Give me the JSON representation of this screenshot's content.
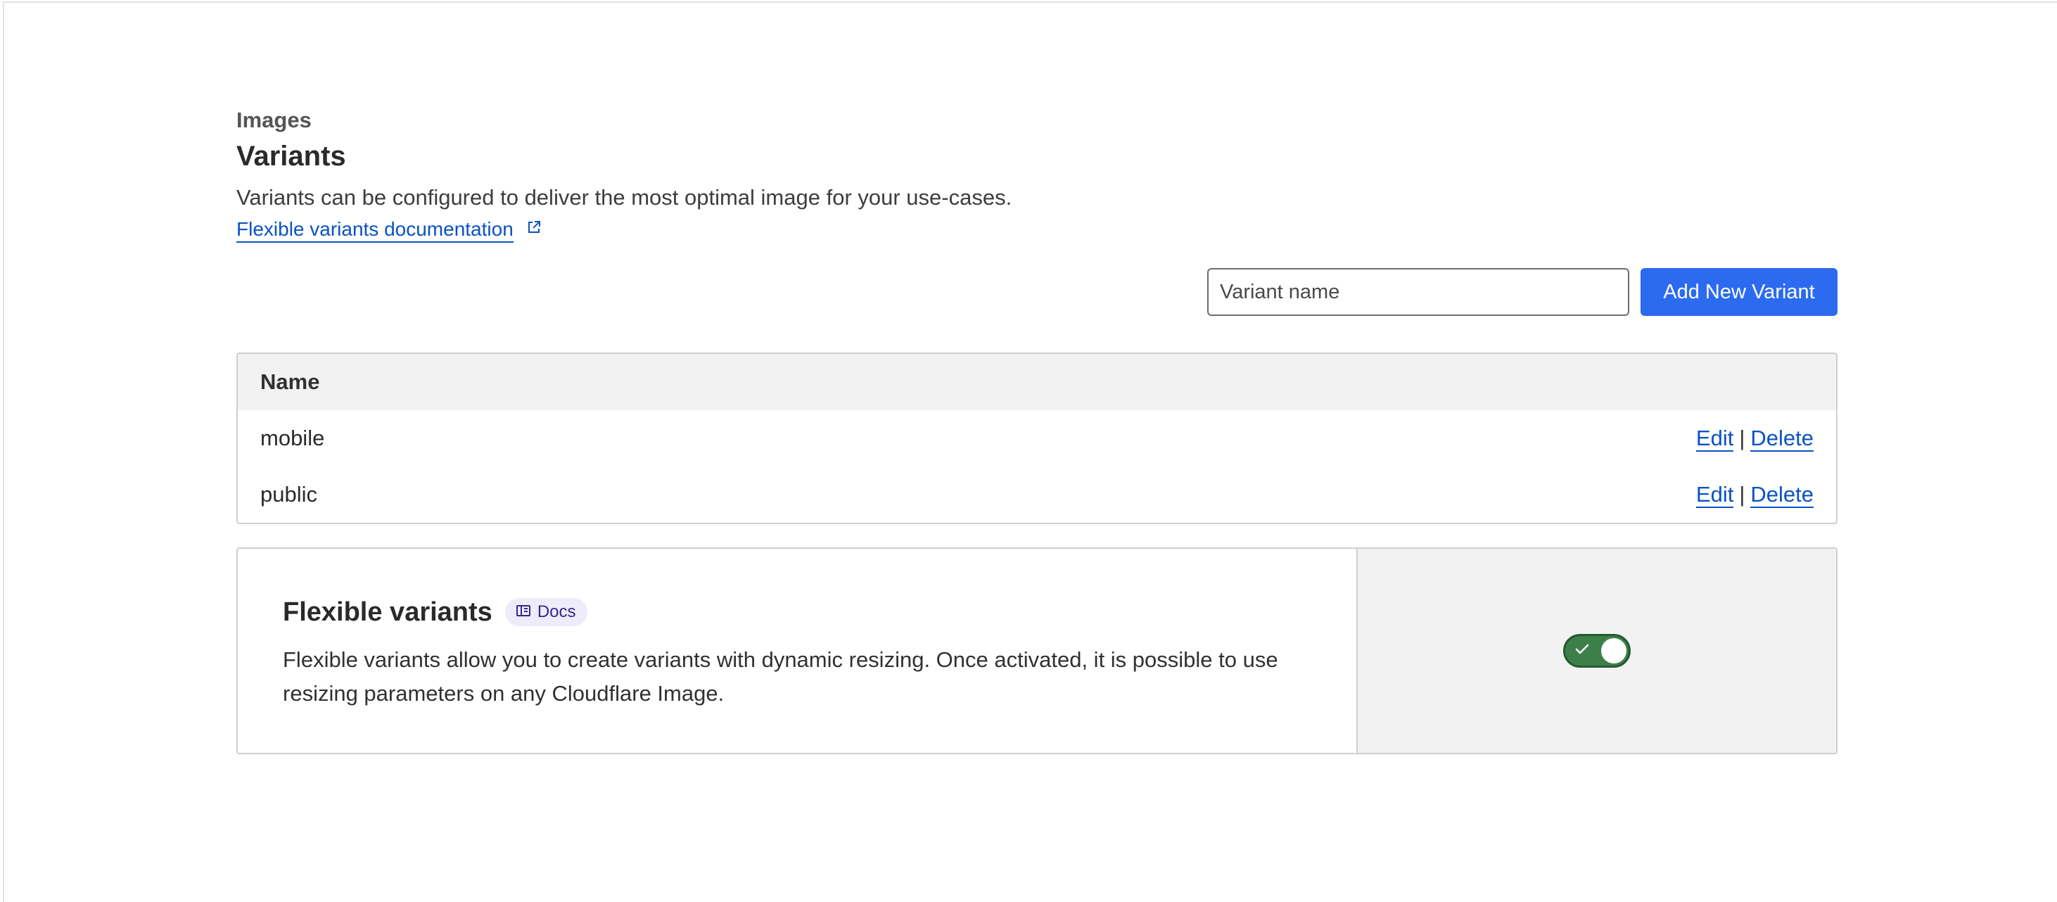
{
  "header": {
    "breadcrumb": "Images",
    "title": "Variants",
    "description": "Variants can be configured to deliver the most optimal image for your use-cases.",
    "docs_link_label": "Flexible variants documentation"
  },
  "toolbar": {
    "search_placeholder": "Variant name",
    "add_button_label": "Add New Variant"
  },
  "table": {
    "column_header": "Name",
    "rows": [
      {
        "name": "mobile",
        "edit_label": "Edit",
        "separator": "|",
        "delete_label": "Delete"
      },
      {
        "name": "public",
        "edit_label": "Edit",
        "separator": "|",
        "delete_label": "Delete"
      }
    ]
  },
  "flexible_variants": {
    "title": "Flexible variants",
    "badge_label": "Docs",
    "description": "Flexible variants allow you to create variants with dynamic resizing. Once activated, it is possible to use resizing parameters on any Cloudflare Image.",
    "enabled": true
  },
  "colors": {
    "primary_button": "#2c6bf0",
    "link": "#0a52c4",
    "toggle_on": "#3d7f4b",
    "badge_bg": "#eeebfb"
  },
  "icons": {
    "docs_link": "external-link-icon",
    "badge": "book-icon",
    "toggle": "check-icon"
  }
}
